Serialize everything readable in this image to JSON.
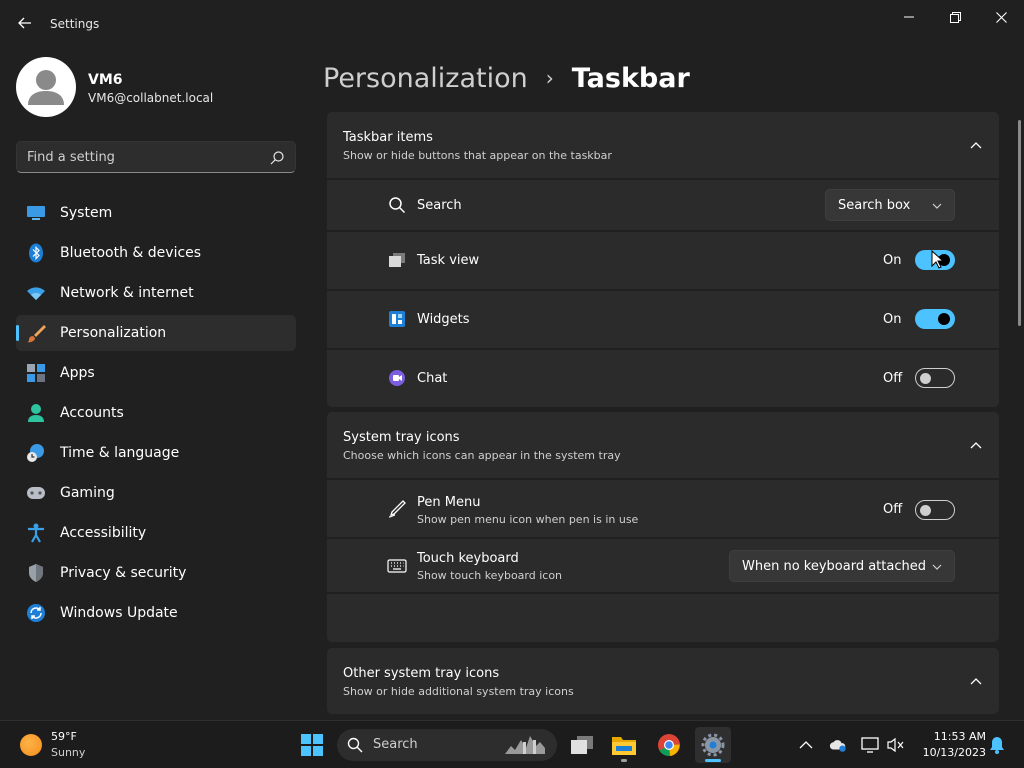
{
  "window": {
    "app_title": "Settings",
    "accent_color": "#4cc2ff"
  },
  "account": {
    "name": "VM6",
    "email": "VM6@collabnet.local"
  },
  "search": {
    "placeholder": "Find a setting"
  },
  "sidebar": {
    "selected": "Personalization",
    "items": [
      {
        "label": "System",
        "icon": "system-icon"
      },
      {
        "label": "Bluetooth & devices",
        "icon": "bluetooth-icon"
      },
      {
        "label": "Network & internet",
        "icon": "wifi-icon"
      },
      {
        "label": "Personalization",
        "icon": "paintbrush-icon"
      },
      {
        "label": "Apps",
        "icon": "apps-icon"
      },
      {
        "label": "Accounts",
        "icon": "person-icon"
      },
      {
        "label": "Time & language",
        "icon": "clock-globe-icon"
      },
      {
        "label": "Gaming",
        "icon": "gamepad-icon"
      },
      {
        "label": "Accessibility",
        "icon": "accessibility-icon"
      },
      {
        "label": "Privacy & security",
        "icon": "shield-icon"
      },
      {
        "label": "Windows Update",
        "icon": "update-icon"
      }
    ]
  },
  "breadcrumb": {
    "parent": "Personalization",
    "separator": "›",
    "current": "Taskbar"
  },
  "taskbar_items": {
    "title": "Taskbar items",
    "subtitle": "Show or hide buttons that appear on the taskbar",
    "search": {
      "label": "Search",
      "value": "Search box"
    },
    "task_view": {
      "label": "Task view",
      "state": "On",
      "on": true
    },
    "widgets": {
      "label": "Widgets",
      "state": "On",
      "on": true
    },
    "chat": {
      "label": "Chat",
      "state": "Off",
      "on": false
    }
  },
  "system_tray": {
    "title": "System tray icons",
    "subtitle": "Choose which icons can appear in the system tray",
    "pen_menu": {
      "label": "Pen Menu",
      "sub": "Show pen menu icon when pen is in use",
      "state": "Off",
      "on": false
    },
    "touch_keyboard": {
      "label": "Touch keyboard",
      "sub": "Show touch keyboard icon",
      "value": "When no keyboard attached"
    }
  },
  "other_tray": {
    "title": "Other system tray icons",
    "subtitle": "Show or hide additional system tray icons"
  },
  "taskbar": {
    "weather_temp": "59°F",
    "weather_desc": "Sunny",
    "search_label": "Search",
    "clock_time": "11:53 AM",
    "clock_date": "10/13/2023"
  }
}
